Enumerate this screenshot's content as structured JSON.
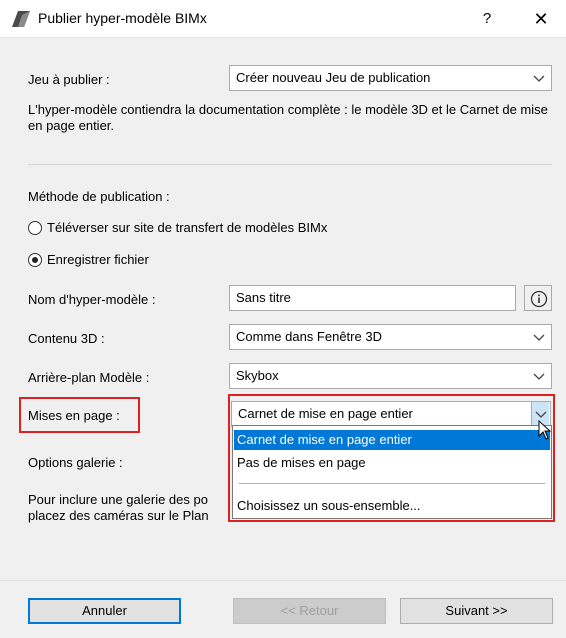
{
  "window": {
    "title": "Publier hyper-modèle BIMx",
    "help": "?",
    "close": "✕"
  },
  "jeu": {
    "label": "Jeu à publier :",
    "value": "Créer nouveau Jeu de publication"
  },
  "description": "L'hyper-modèle contiendra la documentation complète : le modèle 3D et le Carnet de mise en page entier.",
  "methode": {
    "label": "Méthode de publication :",
    "option_upload": "Téléverser sur site de transfert de modèles BIMx",
    "option_save": "Enregistrer fichier",
    "selected": "option_save"
  },
  "nom": {
    "label": "Nom d'hyper-modèle :",
    "value": "Sans titre"
  },
  "contenu": {
    "label": "Contenu 3D :",
    "value": "Comme dans Fenêtre 3D"
  },
  "arriere": {
    "label": "Arrière-plan Modèle :",
    "value": "Skybox"
  },
  "mises": {
    "label": "Mises en page :",
    "value": "Carnet de mise en page entier",
    "options": [
      "Carnet de mise en page entier",
      "Pas de mises en page",
      "Choisissez un sous-ensemble..."
    ]
  },
  "galerie": {
    "label": "Options galerie :",
    "text_line1": "Pour inclure une galerie des po",
    "text_line2": "placez des caméras sur le Plan"
  },
  "buttons": {
    "cancel": "Annuler",
    "back": "<< Retour",
    "next": "Suivant >>"
  },
  "colors": {
    "accent": "#0078d7",
    "highlight_red": "#e02020"
  }
}
